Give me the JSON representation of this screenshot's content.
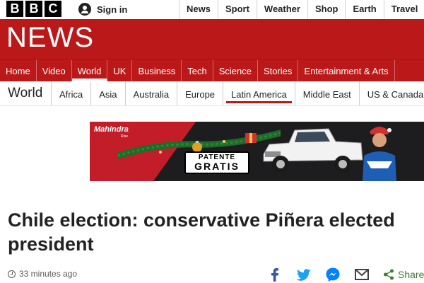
{
  "header": {
    "logo_letters": [
      "B",
      "B",
      "C"
    ],
    "signin_label": "Sign in",
    "nav": [
      "News",
      "Sport",
      "Weather",
      "Shop",
      "Earth",
      "Travel"
    ]
  },
  "banner": {
    "title": "NEWS",
    "background": "#bb1919"
  },
  "main_nav": {
    "items": [
      "Home",
      "Video",
      "World",
      "UK",
      "Business",
      "Tech",
      "Science",
      "Stories",
      "Entertainment & Arts"
    ],
    "active": "World"
  },
  "section_nav": {
    "title": "World",
    "items": [
      "Africa",
      "Asia",
      "Australia",
      "Europe",
      "Latin America",
      "Middle East",
      "US & Canada"
    ],
    "active": "Latin America"
  },
  "ad": {
    "brand": "Mahindra",
    "brand_sub": "Rise",
    "plate_line1": "PATENTE",
    "plate_line2": "GRATIS"
  },
  "article": {
    "headline": "Chile election: conservative Piñera elected president",
    "timestamp": "33 minutes ago",
    "share_label": "Share",
    "share_icons": [
      "facebook-icon",
      "twitter-icon",
      "messenger-icon",
      "email-icon",
      "share-icon"
    ]
  },
  "colors": {
    "accent": "#bb1919",
    "share": "#3e7d32"
  }
}
